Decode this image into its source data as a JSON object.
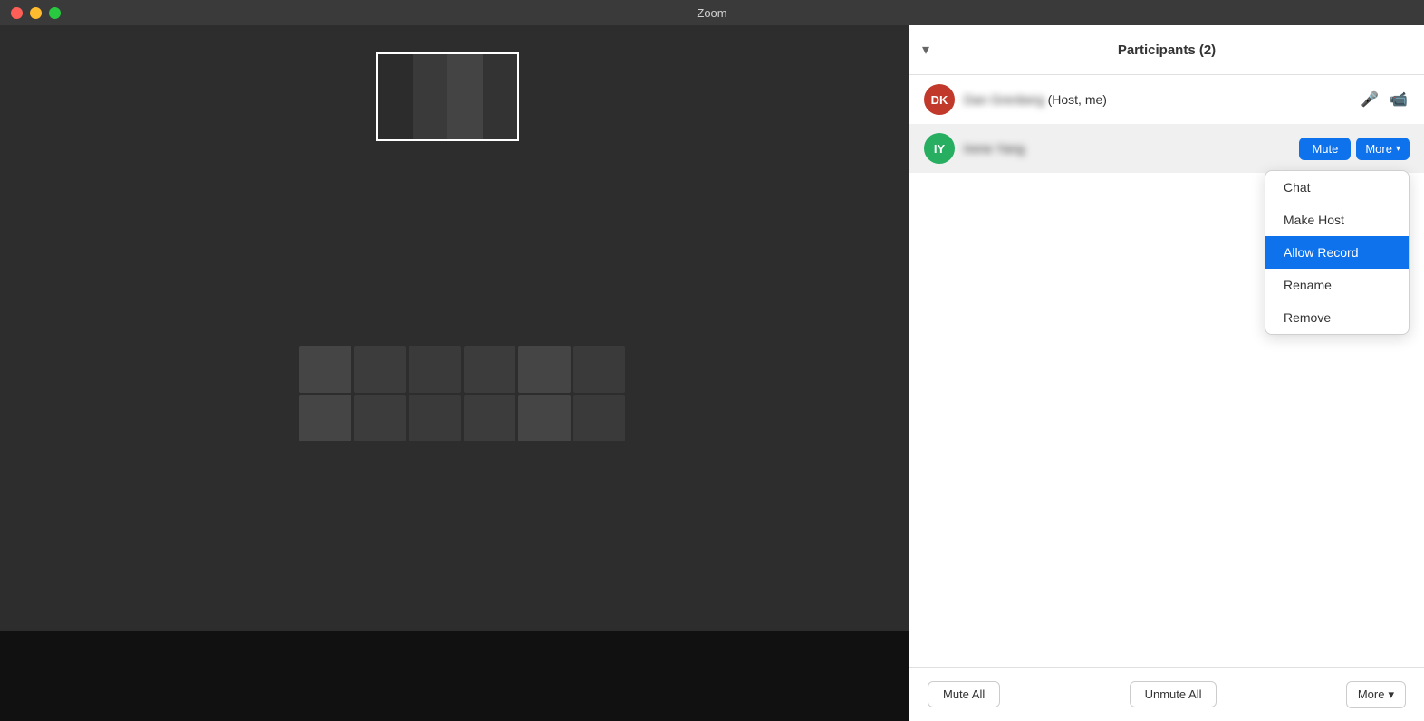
{
  "titleBar": {
    "title": "Zoom",
    "buttons": {
      "close": "close",
      "minimize": "minimize",
      "maximize": "maximize"
    }
  },
  "sidebar": {
    "collapseIcon": "▾",
    "title": "Participants (2)",
    "participants": [
      {
        "id": "dk",
        "initials": "DK",
        "avatarClass": "avatar-dk",
        "name": "Dan Grenberg",
        "nameBlurred": true,
        "role": "(Host, me)",
        "hasMicIcon": true,
        "hasVideoIcon": true
      },
      {
        "id": "iy",
        "initials": "IY",
        "avatarClass": "avatar-iy",
        "name": "Irene Yang",
        "nameBlurred": true,
        "role": "",
        "hasMuteBtn": true,
        "hasMoreBtn": true
      }
    ],
    "dropdown": {
      "items": [
        {
          "label": "Chat",
          "active": false
        },
        {
          "label": "Make Host",
          "active": false
        },
        {
          "label": "Allow Record",
          "active": true
        },
        {
          "label": "Rename",
          "active": false
        },
        {
          "label": "Remove",
          "active": false
        }
      ]
    },
    "footer": {
      "muteAllLabel": "Mute All",
      "unmuteAllLabel": "Unmute All",
      "moreLabel": "More",
      "moreChevron": "▾"
    }
  }
}
